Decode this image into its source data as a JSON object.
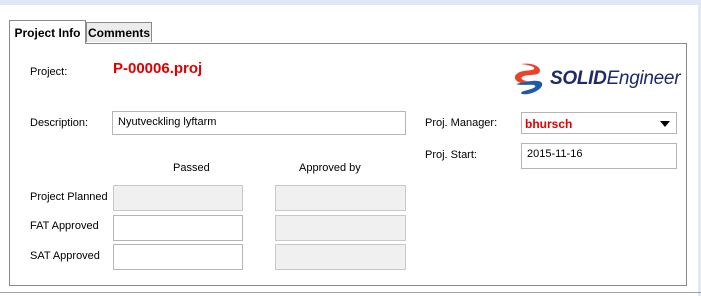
{
  "tabs": [
    {
      "label": "Project Info",
      "active": true
    },
    {
      "label": "Comments",
      "active": false
    }
  ],
  "project": {
    "label": "Project:",
    "value": "P-00006.proj"
  },
  "logo": {
    "name": "SOLIDEngineer",
    "bold": "SOLID",
    "regular": "Engineer",
    "colors": [
      "#e8442a",
      "#1e5aa8",
      "#1e2a6e"
    ]
  },
  "description": {
    "label": "Description:",
    "value": "Nyutveckling lyftarm"
  },
  "manager": {
    "label": "Proj. Manager:",
    "value": "bhursch"
  },
  "start": {
    "label": "Proj. Start:",
    "value": "2015-11-16"
  },
  "milestones": {
    "col_passed": "Passed",
    "col_approved": "Approved by",
    "rows": [
      {
        "label": "Project Planned",
        "passed": "",
        "approved_by": ""
      },
      {
        "label": "FAT Approved",
        "passed": "",
        "approved_by": ""
      },
      {
        "label": "SAT Approved",
        "passed": "",
        "approved_by": ""
      }
    ]
  },
  "colors": {
    "accent_red": "#e00000",
    "panel_border": "#8a8a8a",
    "readonly_bg": "#f0f0f0"
  }
}
